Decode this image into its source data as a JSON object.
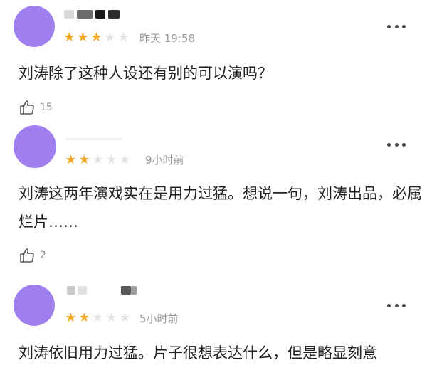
{
  "comments": [
    {
      "rating": 3,
      "time": "昨天 19:58",
      "text": "刘涛除了这种人设还有别的可以演吗？",
      "likes": "15"
    },
    {
      "rating": 2,
      "time": "9小时前",
      "text": "刘涛这两年演戏实在是用力过猛。想说一句，刘涛出品，必属烂片……",
      "likes": "2"
    },
    {
      "rating": 2,
      "time": "5小时前",
      "text": "刘涛依旧用力过猛。片子很想表达什么，但是略显刻意"
    }
  ],
  "colors": {
    "avatar": "#a07ff0",
    "star_on": "#f5a623",
    "star_off": "#e3e3e3"
  },
  "icons": {
    "more": "more-dots-icon",
    "like": "thumbs-up-icon",
    "star": "star-icon"
  }
}
